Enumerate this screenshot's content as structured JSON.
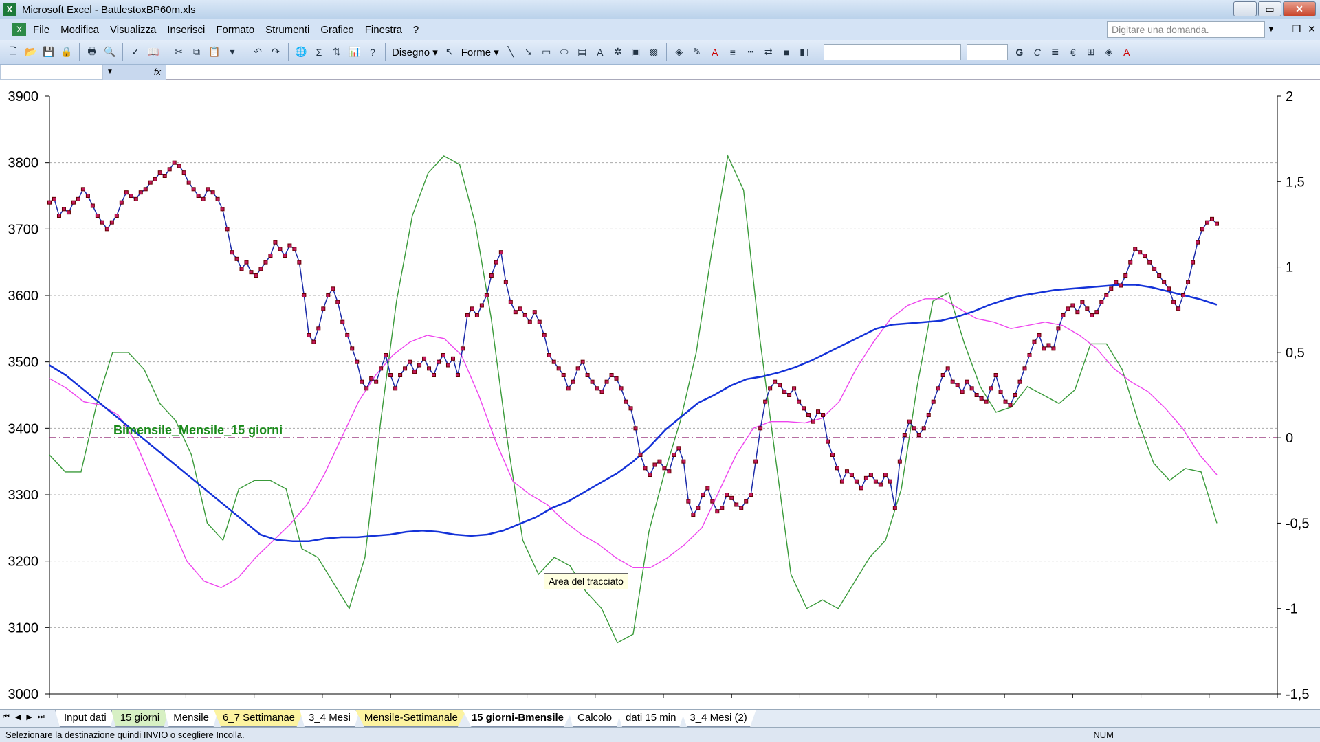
{
  "window": {
    "title": "Microsoft Excel - BattlestoxBP60m.xls"
  },
  "menu": {
    "items": [
      "File",
      "Modifica",
      "Visualizza",
      "Inserisci",
      "Formato",
      "Strumenti",
      "Grafico",
      "Finestra",
      "?"
    ],
    "ask_placeholder": "Digitare una domanda."
  },
  "toolbar": {
    "draw_label": "Disegno ▾",
    "shapes_label": "Forme ▾"
  },
  "formula": {
    "fx": "fx"
  },
  "tooltip": {
    "text": "Area del tracciato"
  },
  "sheets": {
    "tabs": [
      {
        "label": "Input dati",
        "style": "plain"
      },
      {
        "label": "15 giorni",
        "style": "green"
      },
      {
        "label": "Mensile",
        "style": "plain"
      },
      {
        "label": "6_7 Settimanae",
        "style": "yellow"
      },
      {
        "label": "3_4 Mesi",
        "style": "plain"
      },
      {
        "label": "Mensile-Settimanale",
        "style": "yellow"
      },
      {
        "label": "15 giorni-Bmensile",
        "style": "active"
      },
      {
        "label": "Calcolo",
        "style": "plain"
      },
      {
        "label": "dati 15 min",
        "style": "plain"
      },
      {
        "label": "3_4 Mesi (2)",
        "style": "plain"
      }
    ]
  },
  "status": {
    "message": "Selezionare la destinazione quindi INVIO o scegliere Incolla.",
    "num": "NUM"
  },
  "chart_data": {
    "type": "line",
    "annotation": "Bimensile_Mensile_15 giorni",
    "y_left": {
      "min": 3000,
      "max": 3900,
      "ticks": [
        3000,
        3100,
        3200,
        3300,
        3400,
        3500,
        3600,
        3700,
        3800,
        3900
      ]
    },
    "y_right": {
      "min": -1.5,
      "max": 2,
      "ticks": [
        "-1,5",
        "-1",
        "-0,5",
        "0",
        "0,5",
        "1",
        "1,5",
        "2"
      ]
    },
    "reference_line": {
      "axis": "right",
      "value": 0,
      "color": "#8b1a6b"
    },
    "colors": {
      "price": "#1a2aa8",
      "markers": "#c2185b",
      "slow": "#1432d8",
      "mid": "#ee44ee",
      "osc": "#3a9a3a"
    },
    "series": [
      {
        "key": "price",
        "axis": "left",
        "markers": true,
        "values": [
          3740,
          3745,
          3720,
          3730,
          3725,
          3740,
          3745,
          3760,
          3750,
          3735,
          3720,
          3710,
          3700,
          3710,
          3720,
          3740,
          3755,
          3750,
          3745,
          3755,
          3760,
          3770,
          3775,
          3785,
          3780,
          3790,
          3800,
          3795,
          3785,
          3770,
          3760,
          3750,
          3745,
          3760,
          3755,
          3745,
          3730,
          3700,
          3665,
          3655,
          3640,
          3650,
          3635,
          3630,
          3640,
          3650,
          3660,
          3680,
          3670,
          3660,
          3675,
          3670,
          3650,
          3600,
          3540,
          3530,
          3550,
          3580,
          3600,
          3610,
          3590,
          3560,
          3540,
          3520,
          3500,
          3470,
          3460,
          3475,
          3470,
          3490,
          3510,
          3480,
          3460,
          3480,
          3490,
          3500,
          3485,
          3495,
          3505,
          3490,
          3480,
          3500,
          3510,
          3495,
          3505,
          3480,
          3520,
          3570,
          3580,
          3570,
          3585,
          3600,
          3630,
          3650,
          3665,
          3620,
          3590,
          3575,
          3580,
          3570,
          3560,
          3575,
          3560,
          3540,
          3510,
          3500,
          3490,
          3480,
          3460,
          3470,
          3490,
          3500,
          3480,
          3470,
          3460,
          3455,
          3470,
          3480,
          3475,
          3460,
          3440,
          3430,
          3400,
          3360,
          3340,
          3330,
          3345,
          3350,
          3340,
          3335,
          3360,
          3370,
          3350,
          3290,
          3270,
          3280,
          3300,
          3310,
          3290,
          3275,
          3280,
          3300,
          3295,
          3285,
          3280,
          3290,
          3300,
          3350,
          3400,
          3440,
          3460,
          3470,
          3465,
          3455,
          3450,
          3460,
          3440,
          3430,
          3420,
          3410,
          3425,
          3420,
          3380,
          3360,
          3340,
          3320,
          3335,
          3330,
          3320,
          3310,
          3325,
          3330,
          3320,
          3315,
          3330,
          3320,
          3280,
          3350,
          3390,
          3410,
          3400,
          3390,
          3400,
          3420,
          3440,
          3460,
          3480,
          3490,
          3470,
          3465,
          3455,
          3470,
          3460,
          3450,
          3445,
          3440,
          3460,
          3480,
          3455,
          3440,
          3435,
          3450,
          3470,
          3490,
          3510,
          3530,
          3540,
          3520,
          3525,
          3520,
          3550,
          3570,
          3580,
          3585,
          3575,
          3590,
          3580,
          3570,
          3575,
          3590,
          3600,
          3610,
          3620,
          3615,
          3630,
          3650,
          3670,
          3665,
          3660,
          3650,
          3640,
          3630,
          3620,
          3610,
          3590,
          3580,
          3600,
          3620,
          3650,
          3680,
          3700,
          3710,
          3715,
          3708
        ]
      },
      {
        "key": "slow",
        "axis": "left",
        "markers": false,
        "values": [
          3495,
          3480,
          3460,
          3440,
          3420,
          3400,
          3380,
          3360,
          3340,
          3320,
          3300,
          3280,
          3260,
          3240,
          3232,
          3230,
          3230,
          3234,
          3236,
          3236,
          3238,
          3240,
          3244,
          3246,
          3244,
          3240,
          3238,
          3240,
          3246,
          3256,
          3266,
          3280,
          3290,
          3304,
          3318,
          3332,
          3350,
          3372,
          3398,
          3418,
          3438,
          3450,
          3464,
          3474,
          3478,
          3484,
          3492,
          3502,
          3514,
          3526,
          3538,
          3550,
          3556,
          3558,
          3560,
          3562,
          3568,
          3576,
          3586,
          3594,
          3600,
          3604,
          3608,
          3610,
          3612,
          3614,
          3616,
          3616,
          3612,
          3606,
          3600,
          3594,
          3586
        ]
      },
      {
        "key": "mid",
        "axis": "left",
        "markers": false,
        "values": [
          3475,
          3460,
          3440,
          3435,
          3420,
          3380,
          3320,
          3260,
          3200,
          3170,
          3160,
          3175,
          3205,
          3230,
          3255,
          3285,
          3330,
          3385,
          3440,
          3480,
          3510,
          3530,
          3540,
          3535,
          3510,
          3450,
          3380,
          3320,
          3300,
          3285,
          3260,
          3240,
          3225,
          3205,
          3190,
          3190,
          3205,
          3225,
          3250,
          3305,
          3360,
          3400,
          3410,
          3410,
          3408,
          3415,
          3440,
          3490,
          3530,
          3565,
          3585,
          3595,
          3595,
          3580,
          3565,
          3560,
          3550,
          3555,
          3560,
          3555,
          3540,
          3520,
          3490,
          3470,
          3455,
          3430,
          3400,
          3360,
          3330
        ]
      },
      {
        "key": "osc",
        "axis": "right",
        "markers": false,
        "values": [
          -0.1,
          -0.2,
          -0.2,
          0.2,
          0.5,
          0.5,
          0.4,
          0.2,
          0.1,
          -0.1,
          -0.5,
          -0.6,
          -0.3,
          -0.25,
          -0.25,
          -0.3,
          -0.65,
          -0.7,
          -0.85,
          -1.0,
          -0.7,
          0.1,
          0.8,
          1.3,
          1.55,
          1.65,
          1.6,
          1.25,
          0.7,
          0.0,
          -0.6,
          -0.8,
          -0.7,
          -0.75,
          -0.9,
          -1.0,
          -1.2,
          -1.15,
          -0.55,
          -0.2,
          0.1,
          0.5,
          1.1,
          1.65,
          1.45,
          0.6,
          -0.1,
          -0.8,
          -1.0,
          -0.95,
          -1.0,
          -0.85,
          -0.7,
          -0.6,
          -0.3,
          0.3,
          0.8,
          0.85,
          0.55,
          0.3,
          0.15,
          0.18,
          0.3,
          0.25,
          0.2,
          0.28,
          0.55,
          0.55,
          0.4,
          0.1,
          -0.15,
          -0.25,
          -0.18,
          -0.2,
          -0.5
        ]
      }
    ]
  }
}
